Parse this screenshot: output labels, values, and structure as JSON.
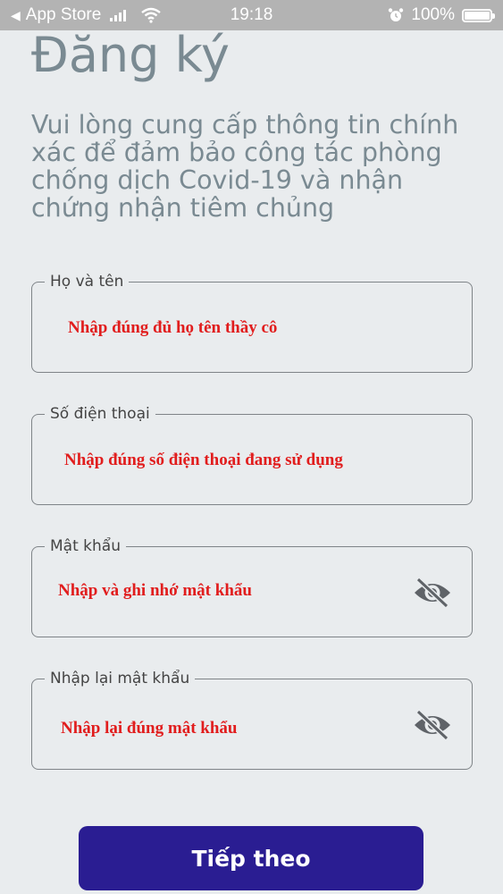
{
  "status_bar": {
    "back_arrow": "◀",
    "carrier": "App Store",
    "signal_icon": "signal-icon",
    "wifi_icon": "wifi-icon",
    "time": "19:18",
    "alarm_icon": "alarm-icon",
    "battery_percent": "100%",
    "battery_level": 1.0
  },
  "header": {
    "title": "Đăng ký",
    "subtitle": "Vui lòng cung cấp thông tin chính xác để đảm bảo công tác phòng chống dịch Covid-19 và nhận chứng nhận tiêm chủng"
  },
  "form": {
    "full_name": {
      "label": "Họ và tên",
      "value": "Nhập đúng đủ họ tên thầy cô"
    },
    "phone": {
      "label": "Số điện thoại",
      "value": "Nhập đúng số điện thoại đang sử dụng"
    },
    "password": {
      "label": "Mật khẩu",
      "value": "Nhập và ghi nhớ mật khẩu",
      "toggle_icon": "eye-off-icon"
    },
    "confirm_password": {
      "label": "Nhập lại mật khẩu",
      "value": "Nhập lại đúng mật khẩu",
      "toggle_icon": "eye-off-icon"
    }
  },
  "actions": {
    "next_label": "Tiếp theo"
  },
  "colors": {
    "background": "#e9ecee",
    "title": "#7a8a92",
    "annotation_red": "#e11d1d",
    "button": "#2a1d92"
  }
}
